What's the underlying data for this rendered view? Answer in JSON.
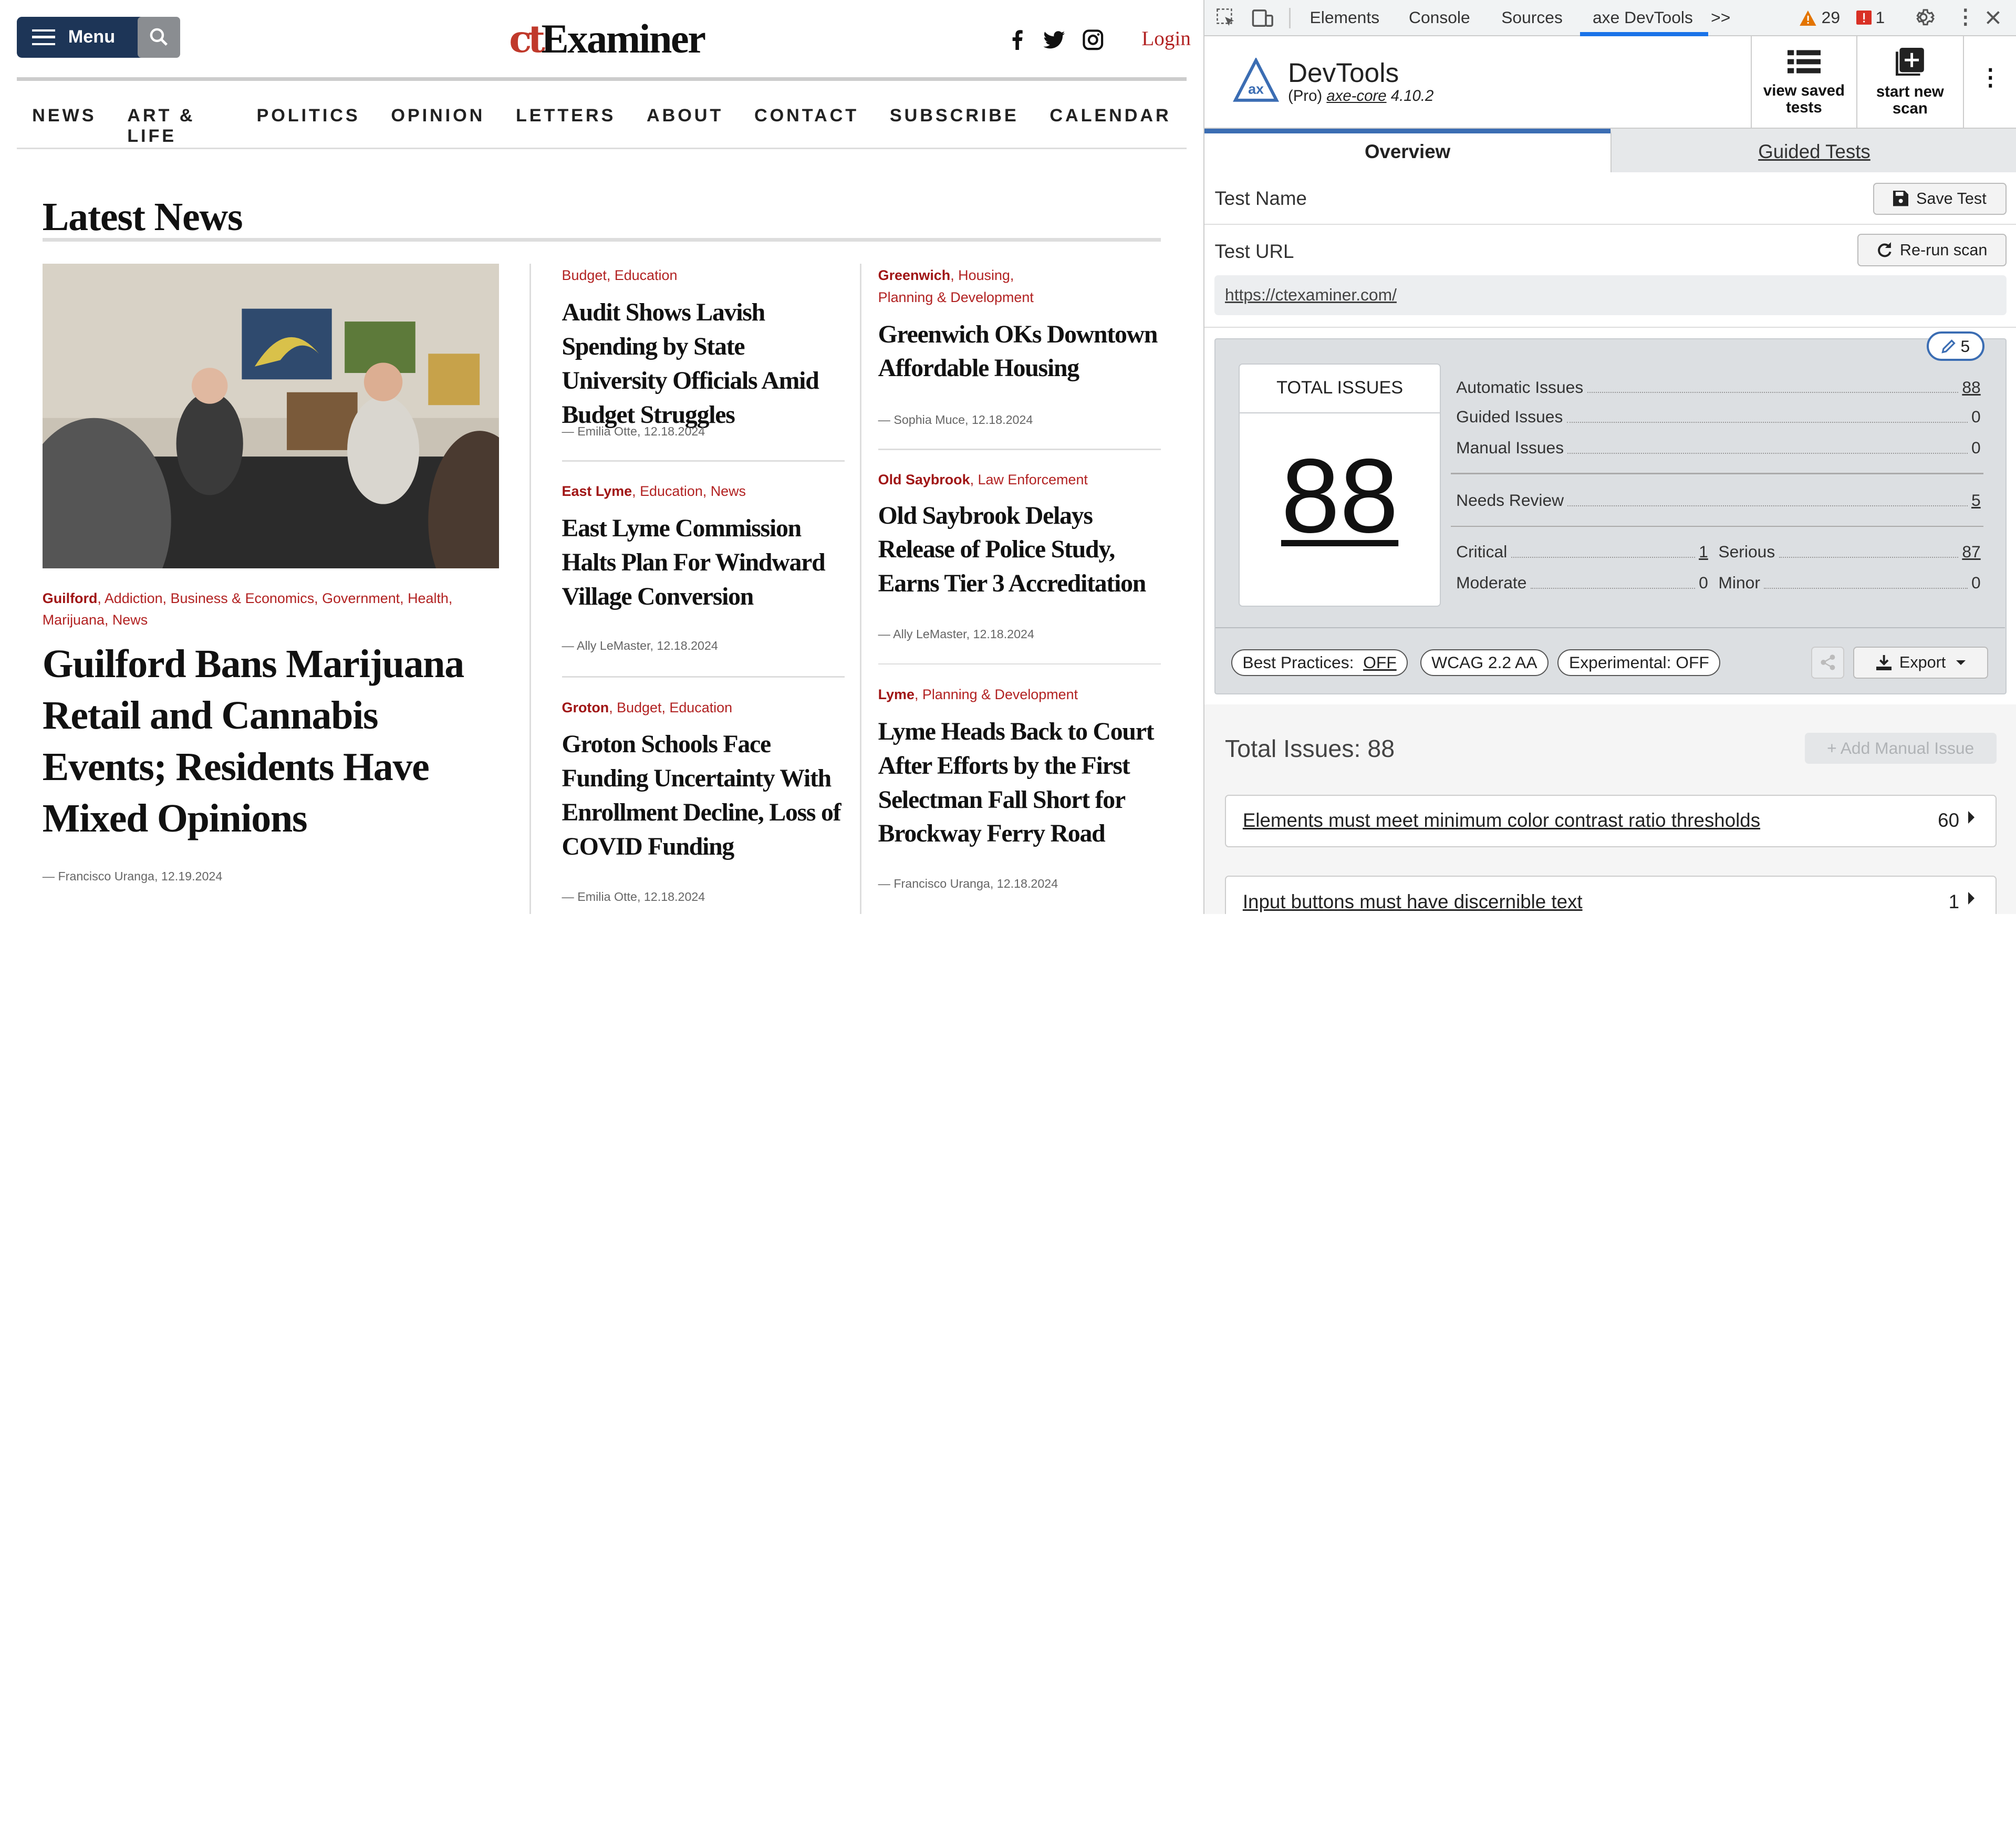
{
  "site": {
    "menu_label": "Menu",
    "logo_mark": "ct",
    "logo_text": "Examiner",
    "login": "Login",
    "nav": [
      "NEWS",
      "ART & LIFE",
      "POLITICS",
      "OPINION",
      "LETTERS",
      "ABOUT",
      "CONTACT",
      "SUBSCRIBE",
      "CALENDAR"
    ],
    "section_title": "Latest News",
    "feature": {
      "cat_primary": "Guilford",
      "cats_rest": ", Addiction, Business & Economics, Government, Health,",
      "cats_line2": "Marijuana, News",
      "headline": "Guilford Bans Marijuana Retail and Cannabis Events; Residents Have Mixed Opinions",
      "byline": "— Francisco Uranga, 12.19.2024"
    },
    "col2": [
      {
        "cats": "Budget, Education",
        "headline": "Audit Shows Lavish Spending by State University Officials Amid Budget Struggles",
        "byline": "— Emilia Otte, 12.18.2024"
      },
      {
        "cat_primary": "East Lyme",
        "cats": ", Education, News",
        "headline": "East Lyme Commission Halts Plan For Windward Village Conversion",
        "byline": "— Ally LeMaster, 12.18.2024"
      },
      {
        "cat_primary": "Groton",
        "cats": ", Budget, Education",
        "headline": "Groton Schools Face Funding Uncertainty With Enrollment Decline, Loss of COVID Funding",
        "byline": "— Emilia Otte, 12.18.2024"
      }
    ],
    "col3": [
      {
        "cat_primary": "Greenwich",
        "cats": ", Housing,",
        "cats_line2": "Planning & Development",
        "headline": "Greenwich OKs Downtown Affordable Housing",
        "byline": "— Sophia Muce, 12.18.2024"
      },
      {
        "cat_primary": "Old Saybrook",
        "cats": ", Law Enforcement",
        "headline": "Old Saybrook Delays Release of Police Study, Earns Tier 3 Accreditation",
        "byline": "— Ally LeMaster, 12.18.2024"
      },
      {
        "cat_primary": "Lyme",
        "cats": ", Planning & Development",
        "headline": "Lyme Heads Back to Court After Efforts by the First Selectman Fall Short for Brockway Ferry Road",
        "byline": "— Francisco Uranga, 12.18.2024"
      }
    ]
  },
  "devtools": {
    "tabs": [
      "Elements",
      "Console",
      "Sources",
      "axe DevTools"
    ],
    "more": ">>",
    "warnings": "29",
    "errors": "1",
    "title": "DevTools",
    "subtitle_pre": "(Pro) ",
    "subtitle_link": "axe-core",
    "subtitle_ver": " 4.10.2",
    "view_saved": "view saved tests",
    "start_new": "start new scan",
    "overview_tab": "Overview",
    "guided_tab": "Guided Tests",
    "test_name_label": "Test Name",
    "save_test": "Save Test",
    "test_url_label": "Test URL",
    "rerun": "Re-run scan",
    "url": "https://ctexaminer.com/",
    "edit_badge": "5",
    "total_issues_label": "TOTAL ISSUES",
    "total_issues_value": "88",
    "rows": {
      "automatic": {
        "label": "Automatic Issues",
        "value": "88"
      },
      "guided": {
        "label": "Guided Issues",
        "value": "0"
      },
      "manual": {
        "label": "Manual Issues",
        "value": "0"
      },
      "review": {
        "label": "Needs Review",
        "value": "5"
      },
      "critical": {
        "label": "Critical",
        "value": "1"
      },
      "serious": {
        "label": "Serious",
        "value": "87"
      },
      "moderate": {
        "label": "Moderate",
        "value": "0"
      },
      "minor": {
        "label": "Minor",
        "value": "0"
      }
    },
    "best_practices_label": "Best Practices:",
    "best_practices_value": "OFF",
    "wcag": "WCAG 2.2 AA",
    "experimental": "Experimental: OFF",
    "export": "Export",
    "total_issues_heading": "Total Issues: 88",
    "add_manual": "+ Add Manual Issue",
    "issues": [
      {
        "title": "Elements must meet minimum color contrast ratio thresholds",
        "count": "60"
      },
      {
        "title": "Input buttons must have discernible text",
        "count": "1"
      }
    ]
  }
}
